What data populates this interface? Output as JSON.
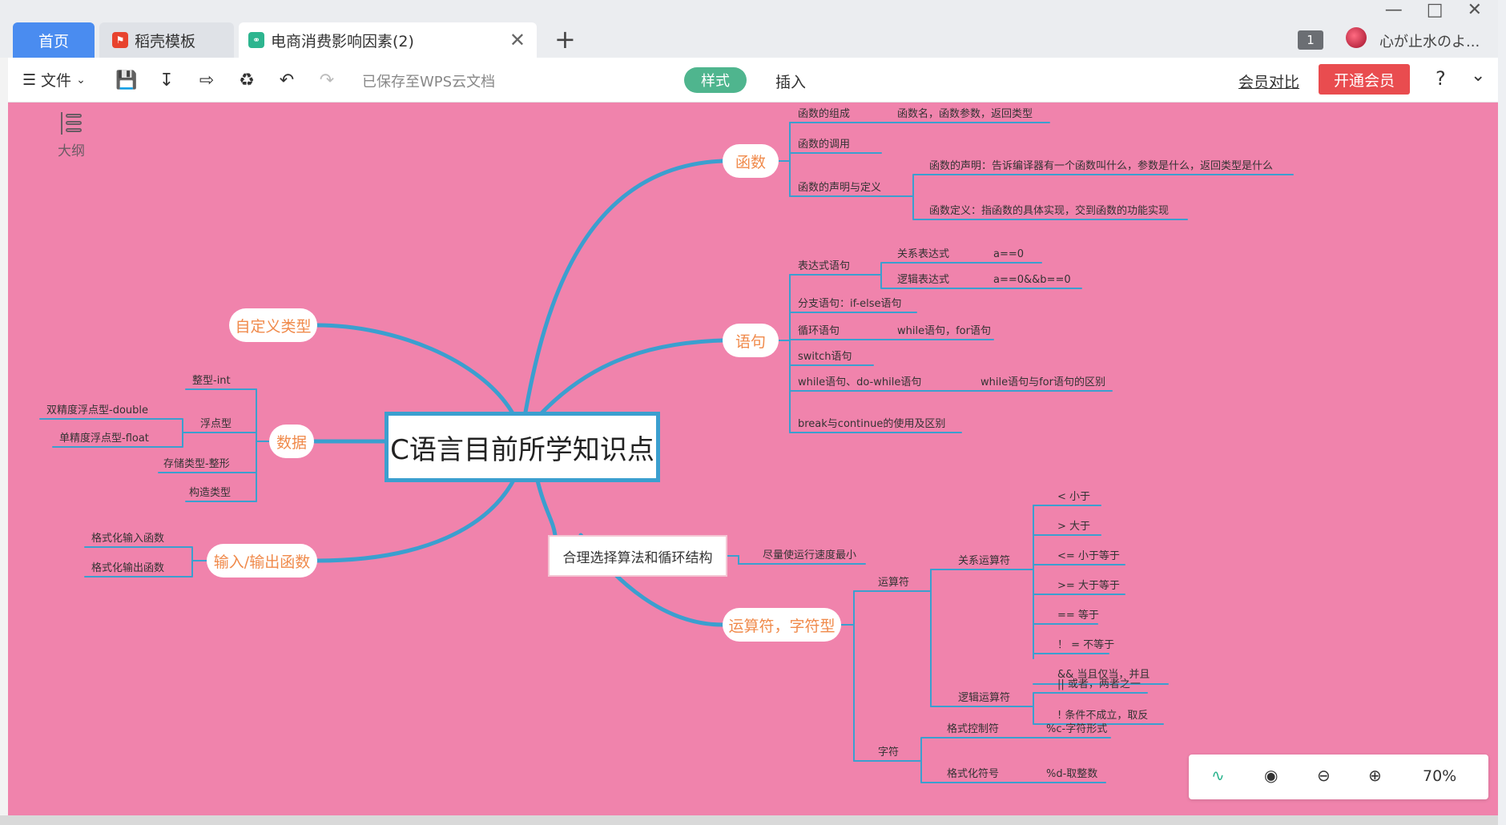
{
  "tabs": {
    "home": "首页",
    "daoke": "稻壳模板",
    "doc": "电商消费影响因素(2)",
    "counter": "1",
    "username": "心が止水のよ..."
  },
  "toolbar": {
    "file": "文件",
    "saved": "已保存至WPS云文档",
    "style": "样式",
    "insert": "插入",
    "member_compare": "会员对比",
    "open_member": "开通会员",
    "help": "?"
  },
  "canvas": {
    "background": "#f083ac",
    "line_color": "#3b9fcf",
    "outline_label": "大纲"
  },
  "mindmap": {
    "root": "C语言目前所学知识点",
    "func": {
      "title": "函数",
      "compose": "函数的组成",
      "compose_leaf": "函数名，函数参数，返回类型",
      "call": "函数的调用",
      "decl": "函数的声明与定义",
      "decl_leaf1": "函数的声明：告诉编译器有一个函数叫什么，参数是什么，返回类型是什么",
      "decl_leaf2": "函数定义：指函数的具体实现，交到函数的功能实现"
    },
    "stmt": {
      "title": "语句",
      "expr": "表达式语句",
      "rel_expr": "关系表达式",
      "rel_val": "a==0",
      "log_expr": "逻辑表达式",
      "log_val": "a==0&&b==0",
      "branch": "分支语句：if-else语句",
      "loop": "循环语句",
      "loop_val": "while语句，for语句",
      "switch": "switch语句",
      "while": "while语句、do-while语句",
      "while_val": "while语句与for语句的区别",
      "break": "break与continue的使用及区别"
    },
    "algo": {
      "title": "合理选择算法和循环结构",
      "leaf": "尽量使运行速度最小"
    },
    "ops": {
      "title": "运算符，字符型",
      "operators": "运算符",
      "relop": "关系运算符",
      "lt": "<   小于",
      "gt": ">   大于",
      "le": "<=  小于等于",
      "ge": ">=  大于等于",
      "eq": "==   等于",
      "ne": "！ =  不等于",
      "and": "&&  当且仅当，并且",
      "logop": "逻辑运算符",
      "or": "||  或者，两者之一",
      "not": "!    条件不成立，取反",
      "char": "字符",
      "fmt_ctrl": "格式控制符",
      "fmt_ctrl_val": "%c-字符形式",
      "fmt_sym": "格式化符号",
      "fmt_sym_val": "%d-取整数"
    },
    "custom": {
      "title": "自定义类型"
    },
    "data": {
      "title": "数据",
      "int": "整型-int",
      "float": "浮点型",
      "double": "双精度浮点型-double",
      "single": "单精度浮点型-float",
      "storage": "存储类型-整形",
      "struct": "构造类型"
    },
    "io": {
      "title": "输入/输出函数",
      "in": "格式化输入函数",
      "out": "格式化输出函数"
    }
  },
  "zoom": {
    "level": "70%"
  }
}
